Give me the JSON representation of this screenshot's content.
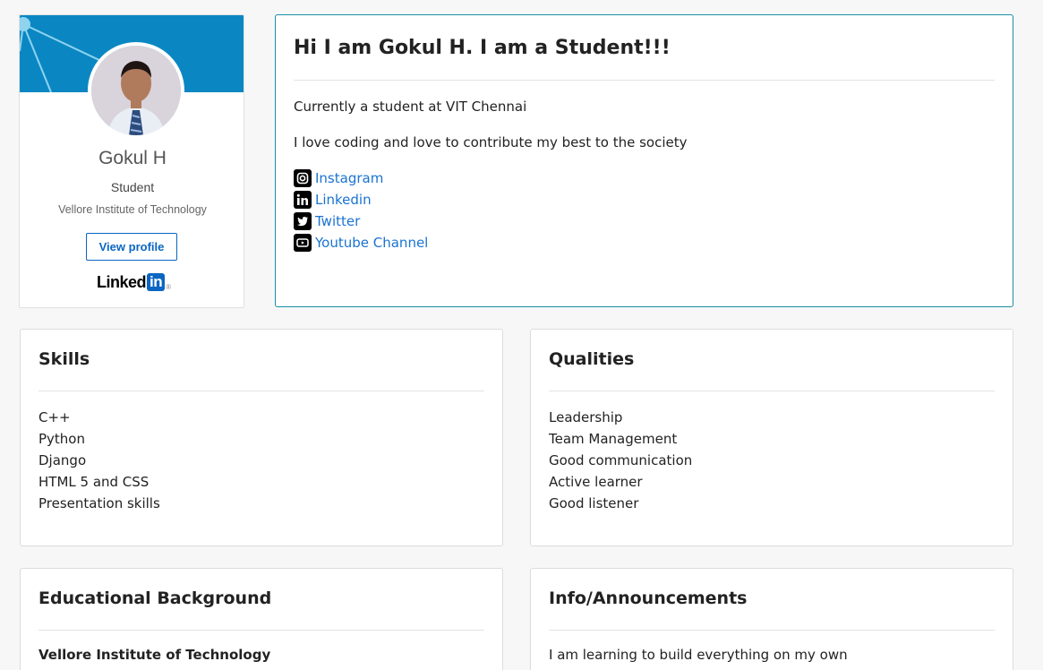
{
  "badge": {
    "name": "Gokul H",
    "title": "Student",
    "organization": "Vellore Institute of Technology",
    "view_profile_label": "View profile",
    "logo_text": "Linked",
    "logo_in": "in",
    "logo_reg": "®",
    "banner_color": "#0a87c3"
  },
  "intro": {
    "heading": "Hi I am Gokul H. I am a Student!!!",
    "line1": "Currently a student at VIT Chennai",
    "line2": "I love coding and love to contribute my best to the society",
    "links": [
      {
        "label": "Instagram",
        "icon": "instagram-icon"
      },
      {
        "label": "Linkedin",
        "icon": "linkedin-icon"
      },
      {
        "label": "Twitter",
        "icon": "twitter-icon"
      },
      {
        "label": "Youtube Channel",
        "icon": "youtube-icon"
      }
    ],
    "link_color": "#1a73d1",
    "accent_border": "#1a8fa5"
  },
  "skills": {
    "heading": "Skills",
    "items": [
      "C++",
      "Python",
      "Django",
      "HTML 5 and CSS",
      "Presentation skills"
    ]
  },
  "qualities": {
    "heading": "Qualities",
    "items": [
      "Leadership",
      "Team Management",
      "Good communication",
      "Active learner",
      "Good listener"
    ]
  },
  "education": {
    "heading": "Educational Background",
    "items": [
      "Vellore Institute of Technology"
    ]
  },
  "info": {
    "heading": "Info/Announcements",
    "items": [
      "I am learning to build everything on my own"
    ]
  }
}
